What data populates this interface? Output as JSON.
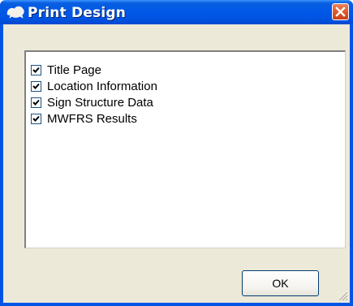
{
  "window": {
    "title": "Print Design",
    "icon": "app-icon",
    "title_color": "#ffffff",
    "titlebar_color": "#0054e3",
    "close_icon": "close-icon",
    "close_color": "#e15b2d"
  },
  "list": {
    "items": [
      {
        "label": "Title Page",
        "checked": true
      },
      {
        "label": "Location Information",
        "checked": true
      },
      {
        "label": "Sign Structure Data",
        "checked": true
      },
      {
        "label": "MWFRS Results",
        "checked": true
      }
    ]
  },
  "footer": {
    "ok_label": "OK",
    "grip_icon": "resize-grip-icon"
  }
}
